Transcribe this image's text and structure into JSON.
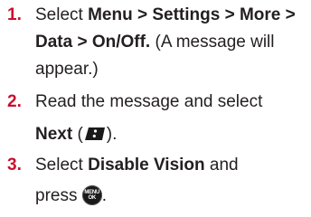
{
  "steps": [
    {
      "number": "1.",
      "text_select": "Select ",
      "path": "Menu > Settings > More >",
      "path2": "Data > On/Off.",
      "note1": " (A message will",
      "note2": "appear.)"
    },
    {
      "number": "2.",
      "text1": "Read the message and select",
      "bold": "Next",
      "open_paren": " (",
      "close_paren": ").",
      "icon": "right-softkey-icon"
    },
    {
      "number": "3.",
      "text_select": "Select ",
      "bold": "Disable Vision",
      "text_and": " and",
      "text_press": "press ",
      "end": ".",
      "icon": "menu-ok-key-icon",
      "key_top": "MENU",
      "key_bottom": "OK"
    }
  ],
  "colors": {
    "step_number": "#c8102e",
    "text": "#231f20",
    "key_fill": "#1a1a1a"
  }
}
